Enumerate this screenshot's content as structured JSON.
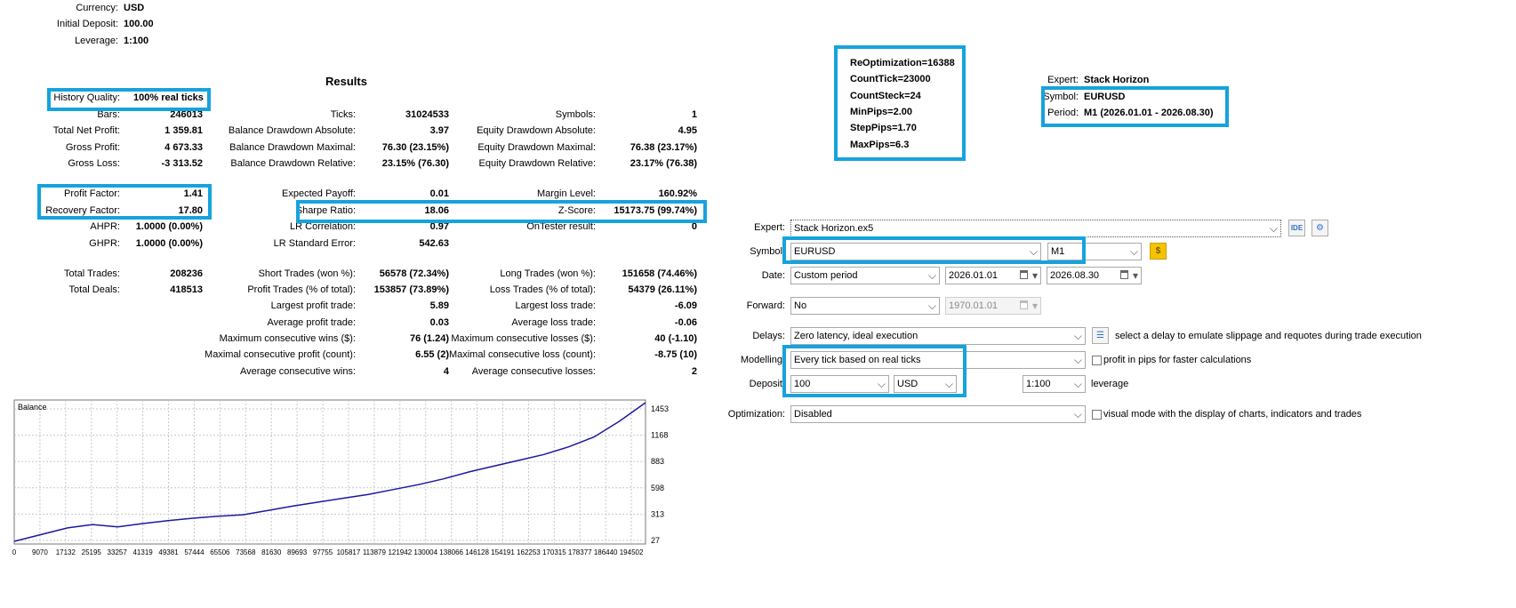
{
  "settings_top": {
    "currency_label": "Currency:",
    "currency_value": "USD",
    "deposit_label": "Initial Deposit:",
    "deposit_value": "100.00",
    "leverage_label": "Leverage:",
    "leverage_value": "1:100"
  },
  "results": {
    "title": "Results",
    "col1": [
      {
        "label": "History Quality:",
        "value": "100% real ticks"
      },
      {
        "label": "Bars:",
        "value": "246013"
      },
      {
        "label": "Total Net Profit:",
        "value": "1 359.81"
      },
      {
        "label": "Gross Profit:",
        "value": "4 673.33"
      },
      {
        "label": "Gross Loss:",
        "value": "-3 313.52"
      },
      {
        "label": "Profit Factor:",
        "value": "1.41"
      },
      {
        "label": "Recovery Factor:",
        "value": "17.80"
      },
      {
        "label": "AHPR:",
        "value": "1.0000 (0.00%)"
      },
      {
        "label": "GHPR:",
        "value": "1.0000 (0.00%)"
      },
      {
        "label": "Total Trades:",
        "value": "208236"
      },
      {
        "label": "Total Deals:",
        "value": "418513"
      }
    ],
    "col2": [
      {
        "label": "Ticks:",
        "value": "31024533"
      },
      {
        "label": "Balance Drawdown Absolute:",
        "value": "3.97"
      },
      {
        "label": "Balance Drawdown Maximal:",
        "value": "76.30 (23.15%)"
      },
      {
        "label": "Balance Drawdown Relative:",
        "value": "23.15% (76.30)"
      },
      {
        "label": "Expected Payoff:",
        "value": "0.01"
      },
      {
        "label": "Sharpe Ratio:",
        "value": "18.06"
      },
      {
        "label": "LR Correlation:",
        "value": "0.97"
      },
      {
        "label": "LR Standard Error:",
        "value": "542.63"
      },
      {
        "label": "Short Trades (won %):",
        "value": "56578 (72.34%)"
      },
      {
        "label": "Profit Trades (% of total):",
        "value": "153857 (73.89%)"
      },
      {
        "label": "Largest profit trade:",
        "value": "5.89"
      },
      {
        "label": "Average profit trade:",
        "value": "0.03"
      },
      {
        "label": "Maximum consecutive wins ($):",
        "value": "76 (1.24)"
      },
      {
        "label": "Maximal consecutive profit (count):",
        "value": "6.55 (2)"
      },
      {
        "label": "Average consecutive wins:",
        "value": "4"
      }
    ],
    "col3": [
      {
        "label": "Symbols:",
        "value": "1"
      },
      {
        "label": "Equity Drawdown Absolute:",
        "value": "4.95"
      },
      {
        "label": "Equity Drawdown Maximal:",
        "value": "76.38 (23.17%)"
      },
      {
        "label": "Equity Drawdown Relative:",
        "value": "23.17% (76.38)"
      },
      {
        "label": "Margin Level:",
        "value": "160.92%"
      },
      {
        "label": "Z-Score:",
        "value": "15173.75 (99.74%)"
      },
      {
        "label": "OnTester result:",
        "value": "0"
      },
      {
        "label": "Long Trades (won %):",
        "value": "151658 (74.46%)"
      },
      {
        "label": "Loss Trades (% of total):",
        "value": "54379 (26.11%)"
      },
      {
        "label": "Largest loss trade:",
        "value": "-6.09"
      },
      {
        "label": "Average loss trade:",
        "value": "-0.06"
      },
      {
        "label": "Maximum consecutive losses ($):",
        "value": "40 (-1.10)"
      },
      {
        "label": "Maximal consecutive loss (count):",
        "value": "-8.75 (10)"
      },
      {
        "label": "Average consecutive losses:",
        "value": "2"
      }
    ]
  },
  "params": {
    "lines": [
      "ReOptimization=16388",
      "CountTick=23000",
      "CountSteck=24",
      "MinPips=2.00",
      "StepPips=1.70",
      "MaxPips=6.3"
    ]
  },
  "info": {
    "expert_label": "Expert:",
    "expert_value": "Stack Horizon",
    "symbol_label": "Symbol:",
    "symbol_value": "EURUSD",
    "period_label": "Period:",
    "period_value": "M1 (2026.01.01 - 2026.08.30)"
  },
  "form": {
    "expert_label": "Expert:",
    "expert_value": "Stack Horizon.ex5",
    "ide_label": "IDE",
    "symbol_label": "Symbol:",
    "symbol_value": "EURUSD",
    "timeframe_value": "M1",
    "date_label": "Date:",
    "date_mode": "Custom period",
    "date_from": "2026.01.01",
    "date_to": "2026.08.30",
    "forward_label": "Forward:",
    "forward_value": "No",
    "forward_date": "1970.01.01",
    "delays_label": "Delays:",
    "delays_value": "Zero latency, ideal execution",
    "delays_hint": "select a delay to emulate slippage and requotes during trade execution",
    "modelling_label": "Modelling:",
    "modelling_value": "Every tick based on real ticks",
    "pips_check_label": "profit in pips for faster calculations",
    "deposit_label": "Deposit:",
    "deposit_value": "100",
    "deposit_currency": "USD",
    "leverage_value": "1:100",
    "leverage_label": "leverage",
    "optimization_label": "Optimization:",
    "optimization_value": "Disabled",
    "visual_check_label": "visual mode with the display of charts, indicators and trades"
  },
  "colors": {
    "highlight": "#16a3dd",
    "balance_line": "#1a1aa0",
    "grid": "#c8c8c8",
    "dollar_button": "#f5c400"
  },
  "icons": [
    "ide-icon",
    "gear-icon",
    "dollar-icon",
    "latency-settings-icon",
    "calendar-icon",
    "dropdown-arrow-icon"
  ],
  "chart_data": {
    "type": "line",
    "title": "Balance",
    "series": [
      {
        "x": [
          0,
          9070,
          17132,
          25195,
          33257,
          41319,
          49381,
          57444,
          65506,
          73568,
          81630,
          89693,
          97755,
          105817,
          113879,
          121942,
          130004,
          138066,
          146128,
          154191,
          162253,
          170315,
          178377,
          186440,
          194502,
          203000
        ],
        "values": [
          27,
          100,
          165,
          200,
          175,
          210,
          240,
          265,
          285,
          300,
          345,
          390,
          430,
          470,
          510,
          560,
          610,
          670,
          740,
          800,
          860,
          920,
          1000,
          1100,
          1260,
          1453
        ]
      }
    ],
    "x_ticks": [
      "0",
      "9070",
      "17132",
      "25195",
      "33257",
      "41319",
      "49381",
      "57444",
      "65506",
      "73568",
      "81630",
      "89693",
      "97755",
      "105817",
      "113879",
      "121942",
      "130004",
      "138066",
      "146128",
      "154191",
      "162253",
      "170315",
      "178377",
      "186440",
      "194502"
    ],
    "y_ticks": [
      "1453",
      "1168",
      "883",
      "598",
      "313",
      "27"
    ],
    "ylim": [
      27,
      1453
    ],
    "grid": true
  }
}
